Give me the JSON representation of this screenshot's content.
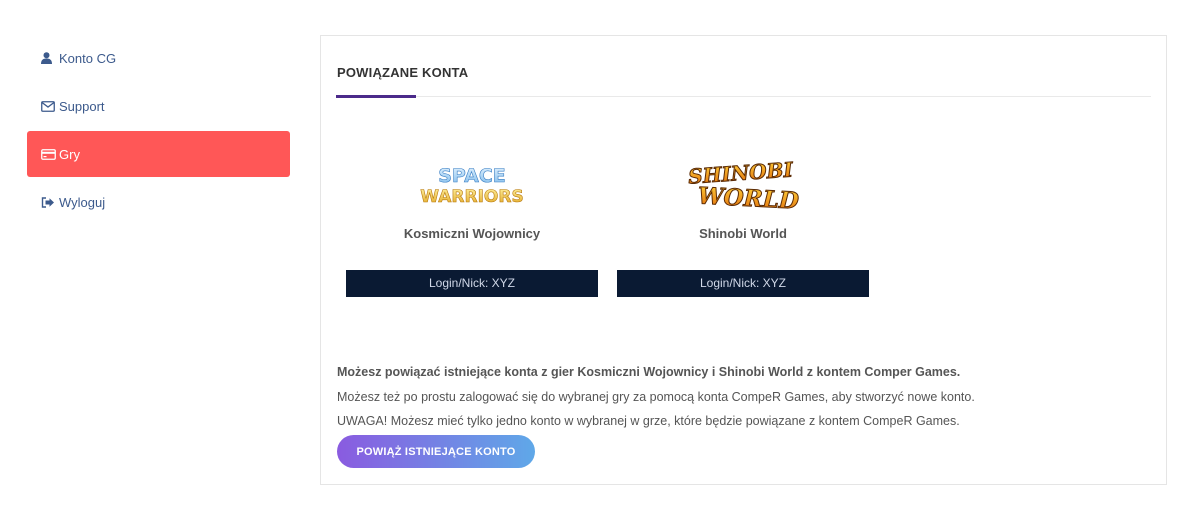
{
  "sidebar": {
    "items": [
      {
        "label": "Konto CG",
        "icon": "user-icon",
        "active": false
      },
      {
        "label": "Support",
        "icon": "envelope-icon",
        "active": false
      },
      {
        "label": "Gry",
        "icon": "credit-card-icon",
        "active": true
      },
      {
        "label": "Wyloguj",
        "icon": "sign-out-icon",
        "active": false
      }
    ]
  },
  "main": {
    "title": "POWIĄZANE KONTA",
    "games": [
      {
        "logo_line1": "SPACE",
        "logo_line2": "WARRIORS",
        "name": "Kosmiczni Wojownicy",
        "login": "Login/Nick: XYZ"
      },
      {
        "logo_line1": "SHINOBI",
        "logo_line2": "WORLD",
        "name": "Shinobi World",
        "login": "Login/Nick: XYZ"
      }
    ],
    "info_bold": "Możesz powiązać istniejące konta z gier Kosmiczni Wojownicy i Shinobi World z kontem Comper Games.",
    "info_line2": "Możesz też po prostu zalogować się do wybranej gry za pomocą konta CompeR Games, aby stworzyć nowe konto.",
    "info_line3": "UWAGA! Możesz mieć tylko jedno konto w wybranej w grze, które będzie powiązane z kontem CompeR Games.",
    "button_label": "POWIĄŻ ISTNIEJĄCE KONTO"
  },
  "colors": {
    "active": "#ff5757",
    "link": "#3c5a8c",
    "accent": "#4b2a8a",
    "login_bar": "#0a1a33"
  }
}
